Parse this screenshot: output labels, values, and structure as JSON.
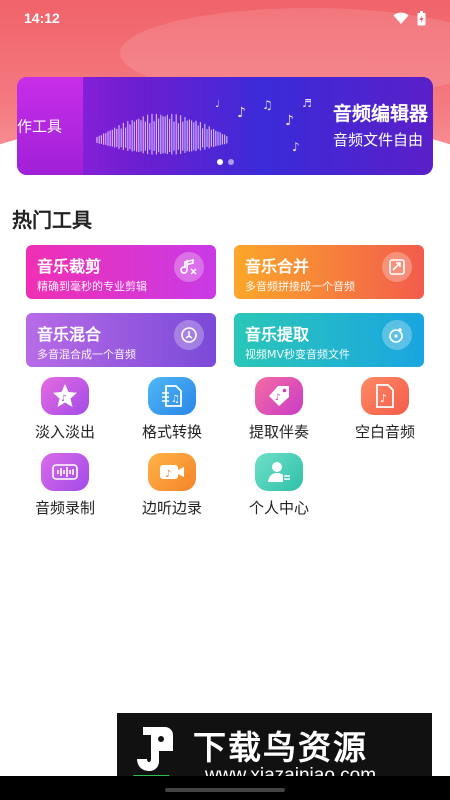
{
  "status_bar": {
    "time": "14:12"
  },
  "banner": {
    "left_fragment": "作工具",
    "title": "音频编辑器",
    "subtitle": "音频文件自由",
    "slides": 2,
    "active_slide": 1
  },
  "section": {
    "title": "热门工具"
  },
  "feature_cards": [
    {
      "title": "音乐裁剪",
      "subtitle": "精确到毫秒的专业剪辑",
      "icon": "music-note-scissors-icon"
    },
    {
      "title": "音乐合并",
      "subtitle": "多音频拼接成一个音频",
      "icon": "merge-icon"
    },
    {
      "title": "音乐混合",
      "subtitle": "多音混合成一个音频",
      "icon": "mix-icon"
    },
    {
      "title": "音乐提取",
      "subtitle": "视频MV秒变音频文件",
      "icon": "extract-disc-icon"
    }
  ],
  "tools": [
    {
      "label": "淡入淡出",
      "icon": "star-music-icon"
    },
    {
      "label": "格式转换",
      "icon": "file-convert-icon"
    },
    {
      "label": "提取伴奏",
      "icon": "tag-music-icon"
    },
    {
      "label": "空白音频",
      "icon": "blank-audio-file-icon"
    },
    {
      "label": "音频录制",
      "icon": "record-waveform-icon"
    },
    {
      "label": "边听边录",
      "icon": "video-record-icon"
    },
    {
      "label": "个人中心",
      "icon": "user-center-icon"
    }
  ],
  "watermark": {
    "brand": "下载鸟资源",
    "url": "www.xiazainiao.com"
  },
  "colors": {
    "header": "#f0636a",
    "cut": "#f02fb4",
    "merge": "#fba72a",
    "mix": "#9a5ae0",
    "extract": "#2bc7b8"
  }
}
